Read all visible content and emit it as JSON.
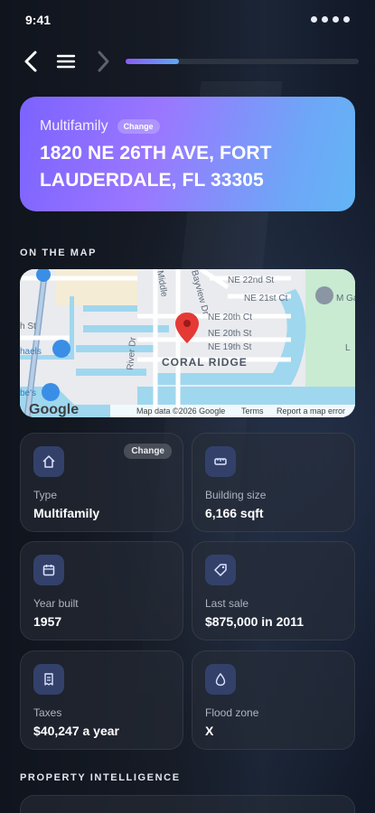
{
  "status": {
    "time": "9:41"
  },
  "nav": {
    "progress": 0.23
  },
  "property": {
    "type": "Multifamily",
    "change_label": "Change",
    "address": "1820 NE 26TH AVE, FORT LAUDERDALE, FL 33305"
  },
  "map_section": {
    "title": "ON THE MAP",
    "labels": {
      "neighborhood": "CORAL RIDGE",
      "ne20ct": "NE 20th Ct",
      "ne20st": "NE 20th St",
      "ne19st": "NE 19th St",
      "ne21ct": "NE 21st Ct",
      "ne22st": "NE 22nd St",
      "bayview": "Bayview Dr",
      "middle": "Middle",
      "river": "River Dr",
      "st": "h St",
      "shaels": "haels",
      "bes": "be's",
      "gardens": "M Ga",
      "l": "L",
      "attribution": "Map data ©2026 Google",
      "terms": "Terms",
      "report": "Report a map error",
      "google": "Google"
    }
  },
  "facts": [
    {
      "icon": "home-icon",
      "label": "Type",
      "value": "Multifamily",
      "change": "Change"
    },
    {
      "icon": "ruler-icon",
      "label": "Building size",
      "value": "6,166 sqft"
    },
    {
      "icon": "calendar-icon",
      "label": "Year built",
      "value": "1957"
    },
    {
      "icon": "tag-icon",
      "label": "Last sale",
      "value": "$875,000 in 2011"
    },
    {
      "icon": "receipt-icon",
      "label": "Taxes",
      "value": "$40,247 a year"
    },
    {
      "icon": "droplet-icon",
      "label": "Flood zone",
      "value": "X"
    }
  ],
  "intel_section": {
    "title": "PROPERTY INTELLIGENCE"
  }
}
